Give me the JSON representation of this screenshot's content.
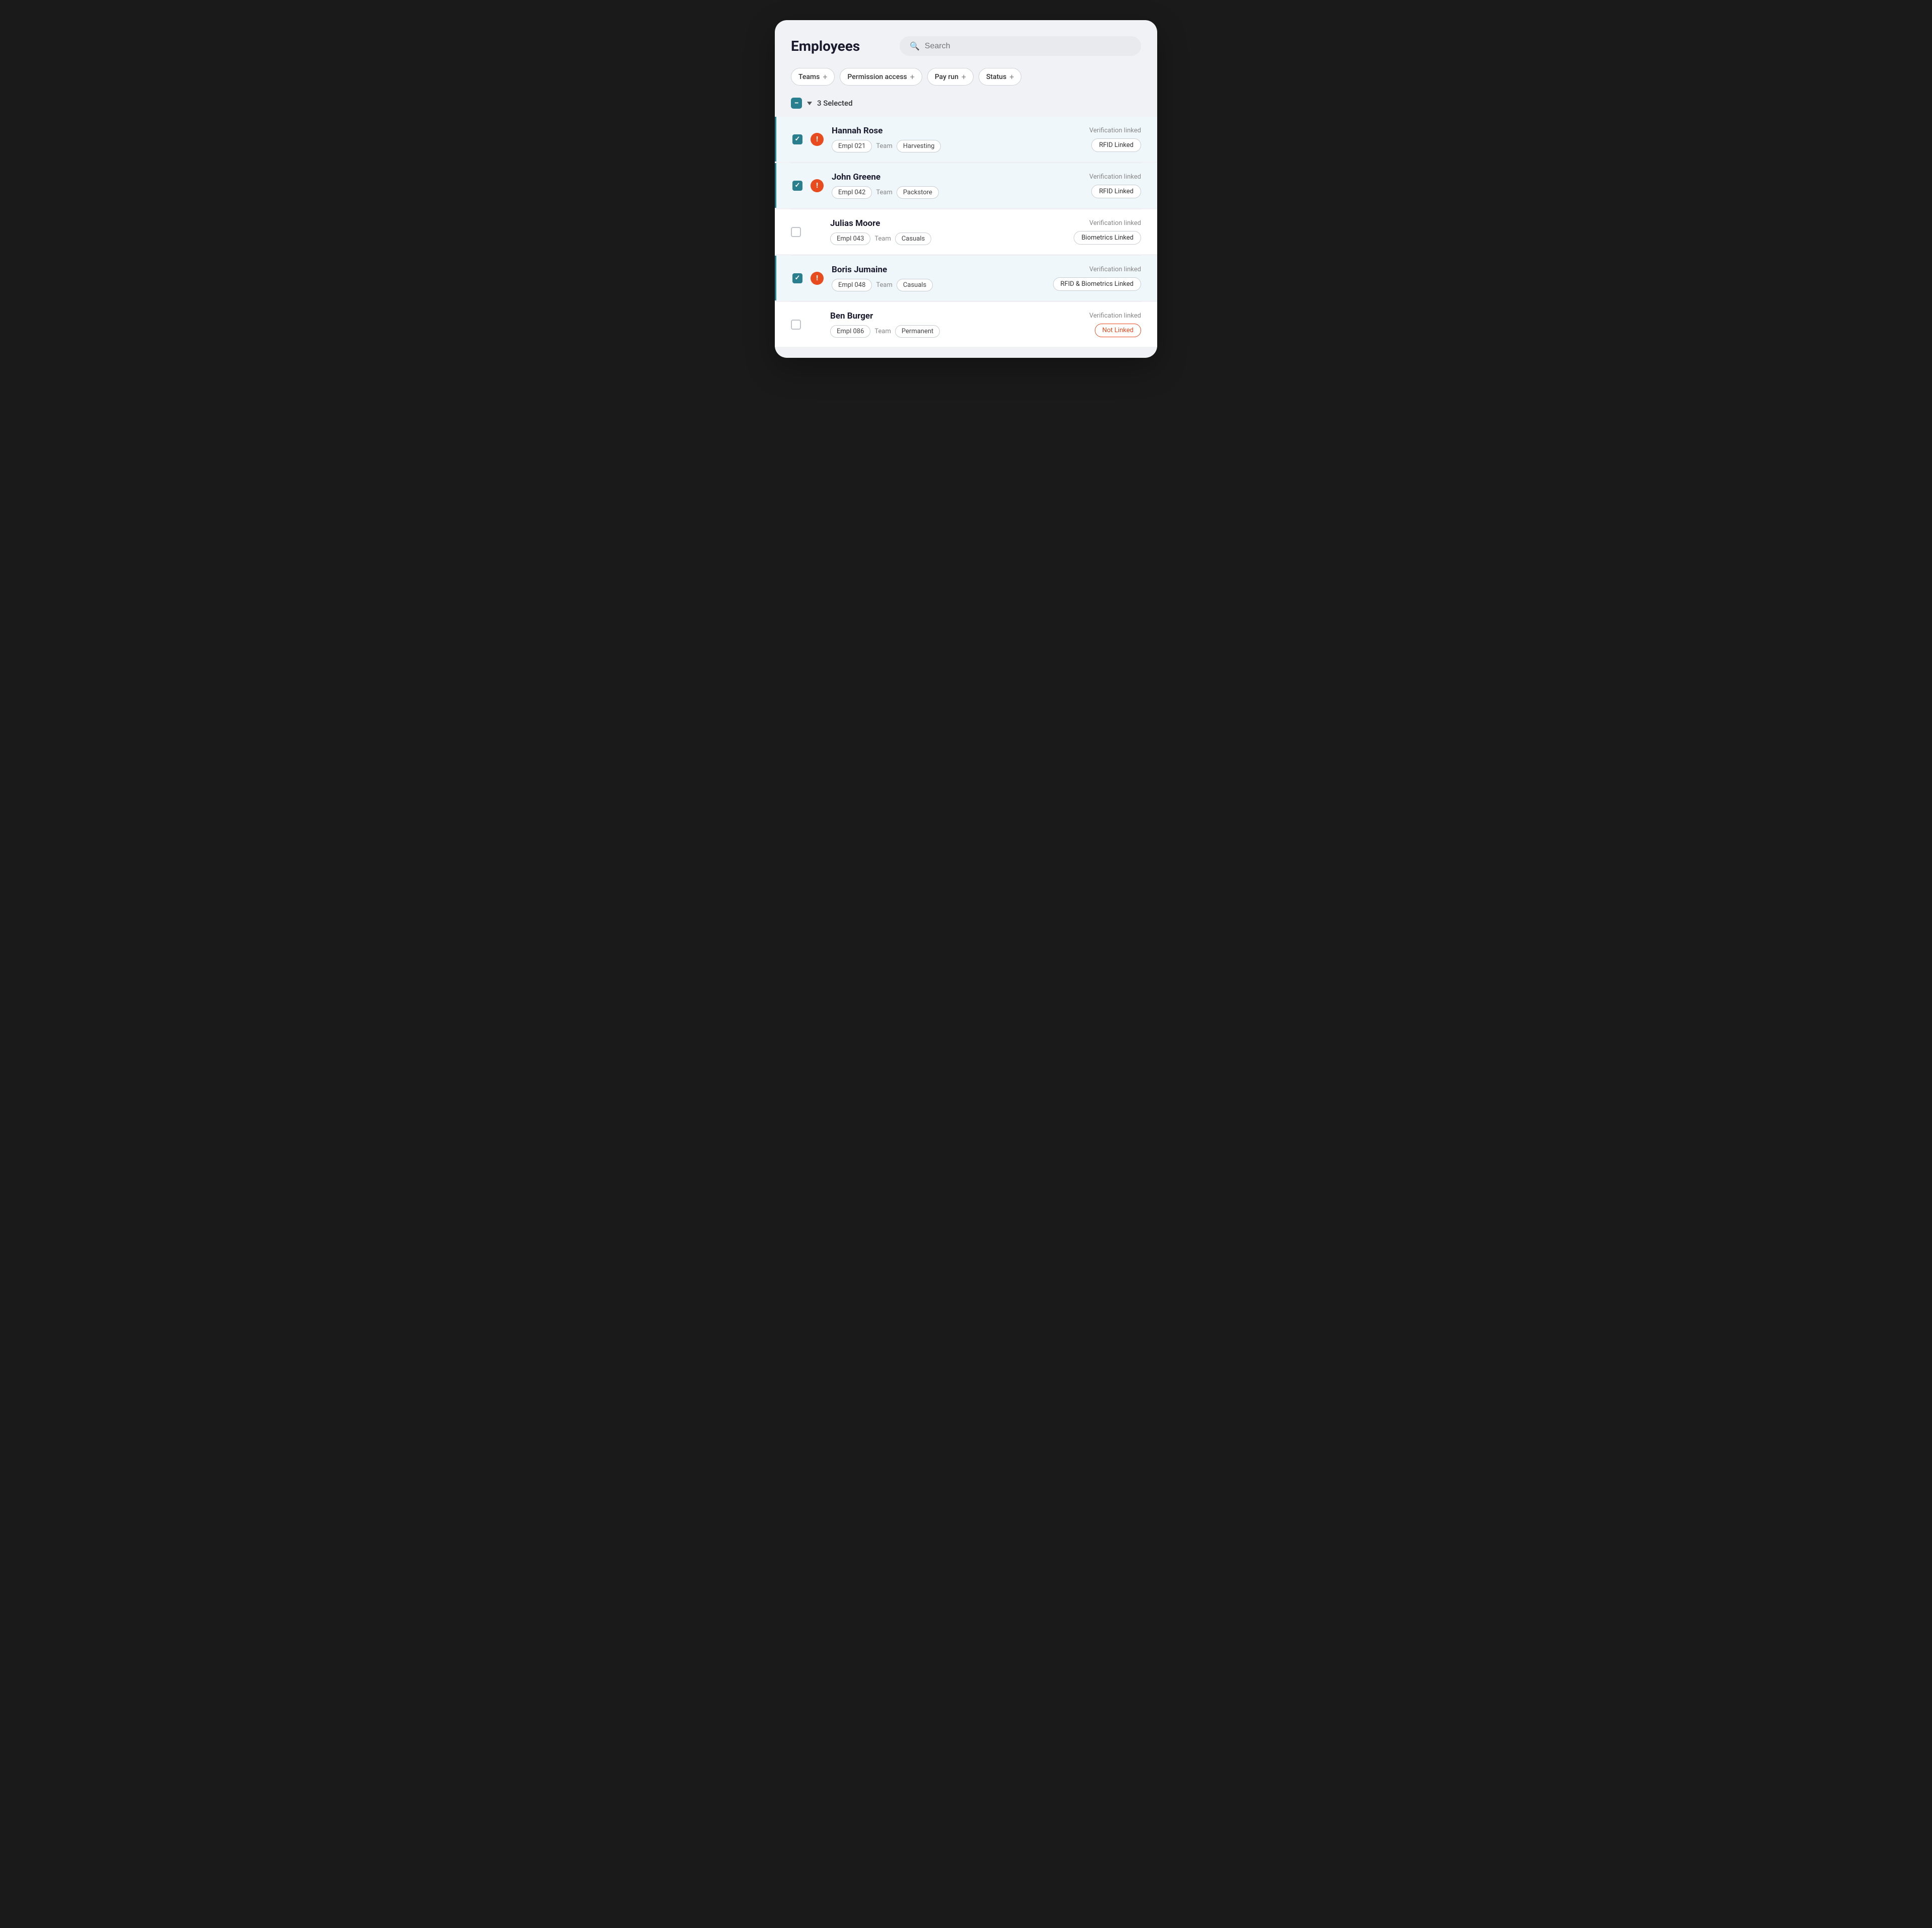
{
  "header": {
    "title": "Employees",
    "search_placeholder": "Search"
  },
  "filters": [
    {
      "id": "teams",
      "label": "Teams"
    },
    {
      "id": "permission-access",
      "label": "Permission access"
    },
    {
      "id": "pay-run",
      "label": "Pay run"
    },
    {
      "id": "status",
      "label": "Status"
    }
  ],
  "selection": {
    "count_label": "3 Selected"
  },
  "employees": [
    {
      "id": "emp1",
      "name": "Hannah Rose",
      "empl_id": "Empl 021",
      "team_label": "Team",
      "team": "Harvesting",
      "selected": true,
      "has_alert": true,
      "verification_label": "Verification linked",
      "verification_badge": "RFID Linked",
      "badge_not_linked": false
    },
    {
      "id": "emp2",
      "name": "John Greene",
      "empl_id": "Empl 042",
      "team_label": "Team",
      "team": "Packstore",
      "selected": true,
      "has_alert": true,
      "verification_label": "Verification linked",
      "verification_badge": "RFID Linked",
      "badge_not_linked": false
    },
    {
      "id": "emp3",
      "name": "Julias Moore",
      "empl_id": "Empl 043",
      "team_label": "Team",
      "team": "Casuals",
      "selected": false,
      "has_alert": false,
      "verification_label": "Verification linked",
      "verification_badge": "Biometrics Linked",
      "badge_not_linked": false
    },
    {
      "id": "emp4",
      "name": "Boris Jumaine",
      "empl_id": "Empl 048",
      "team_label": "Team",
      "team": "Casuals",
      "selected": true,
      "has_alert": true,
      "verification_label": "Verification linked",
      "verification_badge": "RFID & Biometrics Linked",
      "badge_not_linked": false
    },
    {
      "id": "emp5",
      "name": "Ben Burger",
      "empl_id": "Empl 086",
      "team_label": "Team",
      "team": "Permanent",
      "selected": false,
      "has_alert": false,
      "verification_label": "Verification linked",
      "verification_badge": "Not Linked",
      "badge_not_linked": true
    }
  ]
}
